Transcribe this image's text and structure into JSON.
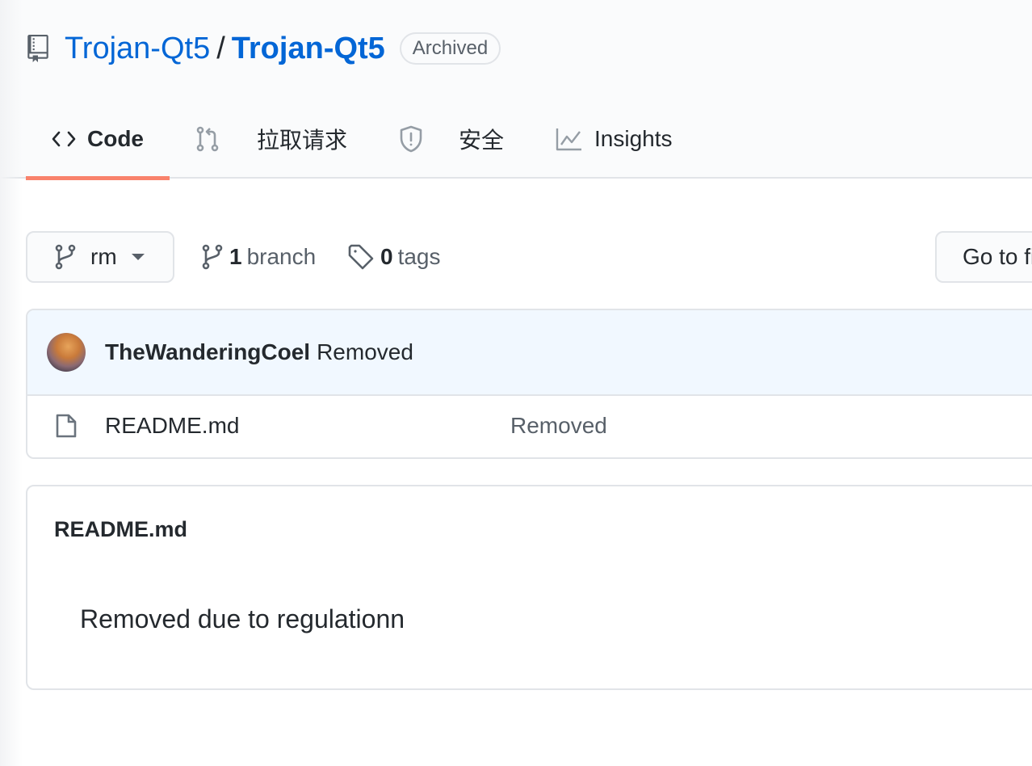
{
  "repo": {
    "owner": "Trojan-Qt5",
    "separator": "/",
    "name": "Trojan-Qt5",
    "badge": "Archived",
    "icon": "repo-icon"
  },
  "tabs": [
    {
      "label": "Code",
      "icon": "code-icon",
      "selected": true
    },
    {
      "label": "拉取请求",
      "icon": "git-pull-request-icon",
      "selected": false
    },
    {
      "label": "安全",
      "icon": "shield-icon",
      "selected": false
    },
    {
      "label": "Insights",
      "icon": "graph-icon",
      "selected": false
    }
  ],
  "toolbar": {
    "branch_selector": {
      "value": "rm",
      "icon": "git-branch-icon",
      "caret": "triangle-down-icon"
    },
    "branches": {
      "count": "1",
      "label": "branch"
    },
    "tags": {
      "count": "0",
      "label": "tags"
    },
    "goto_file": "Go to file"
  },
  "commit": {
    "author": "TheWanderingCoel",
    "message": "Removed",
    "status": "✕",
    "status_color": "#cb2431"
  },
  "files": [
    {
      "name": "README.md",
      "commit_message": "Removed",
      "icon": "file-icon"
    }
  ],
  "readme": {
    "title": "README.md",
    "body": "Removed due to regulationn"
  },
  "colors": {
    "link": "#0366d6",
    "tab_underline": "#f9826c",
    "commit_bg": "#f1f8ff"
  }
}
